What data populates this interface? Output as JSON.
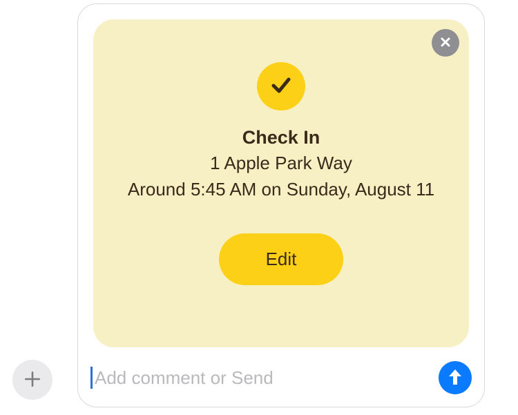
{
  "card": {
    "title": "Check In",
    "address": "1 Apple Park Way",
    "time_text": "Around 5:45 AM on Sunday, August 11",
    "edit_label": "Edit"
  },
  "input": {
    "placeholder": "Add comment or Send",
    "value": ""
  },
  "colors": {
    "card_bg": "#f8f0c5",
    "accent_yellow": "#fcd017",
    "send_blue": "#0a7aff",
    "close_gray": "#8e8e93",
    "text": "#3a2a1a"
  },
  "icons": {
    "check": "checkmark-icon",
    "close": "close-icon",
    "plus": "plus-icon",
    "send": "arrow-up-icon"
  }
}
